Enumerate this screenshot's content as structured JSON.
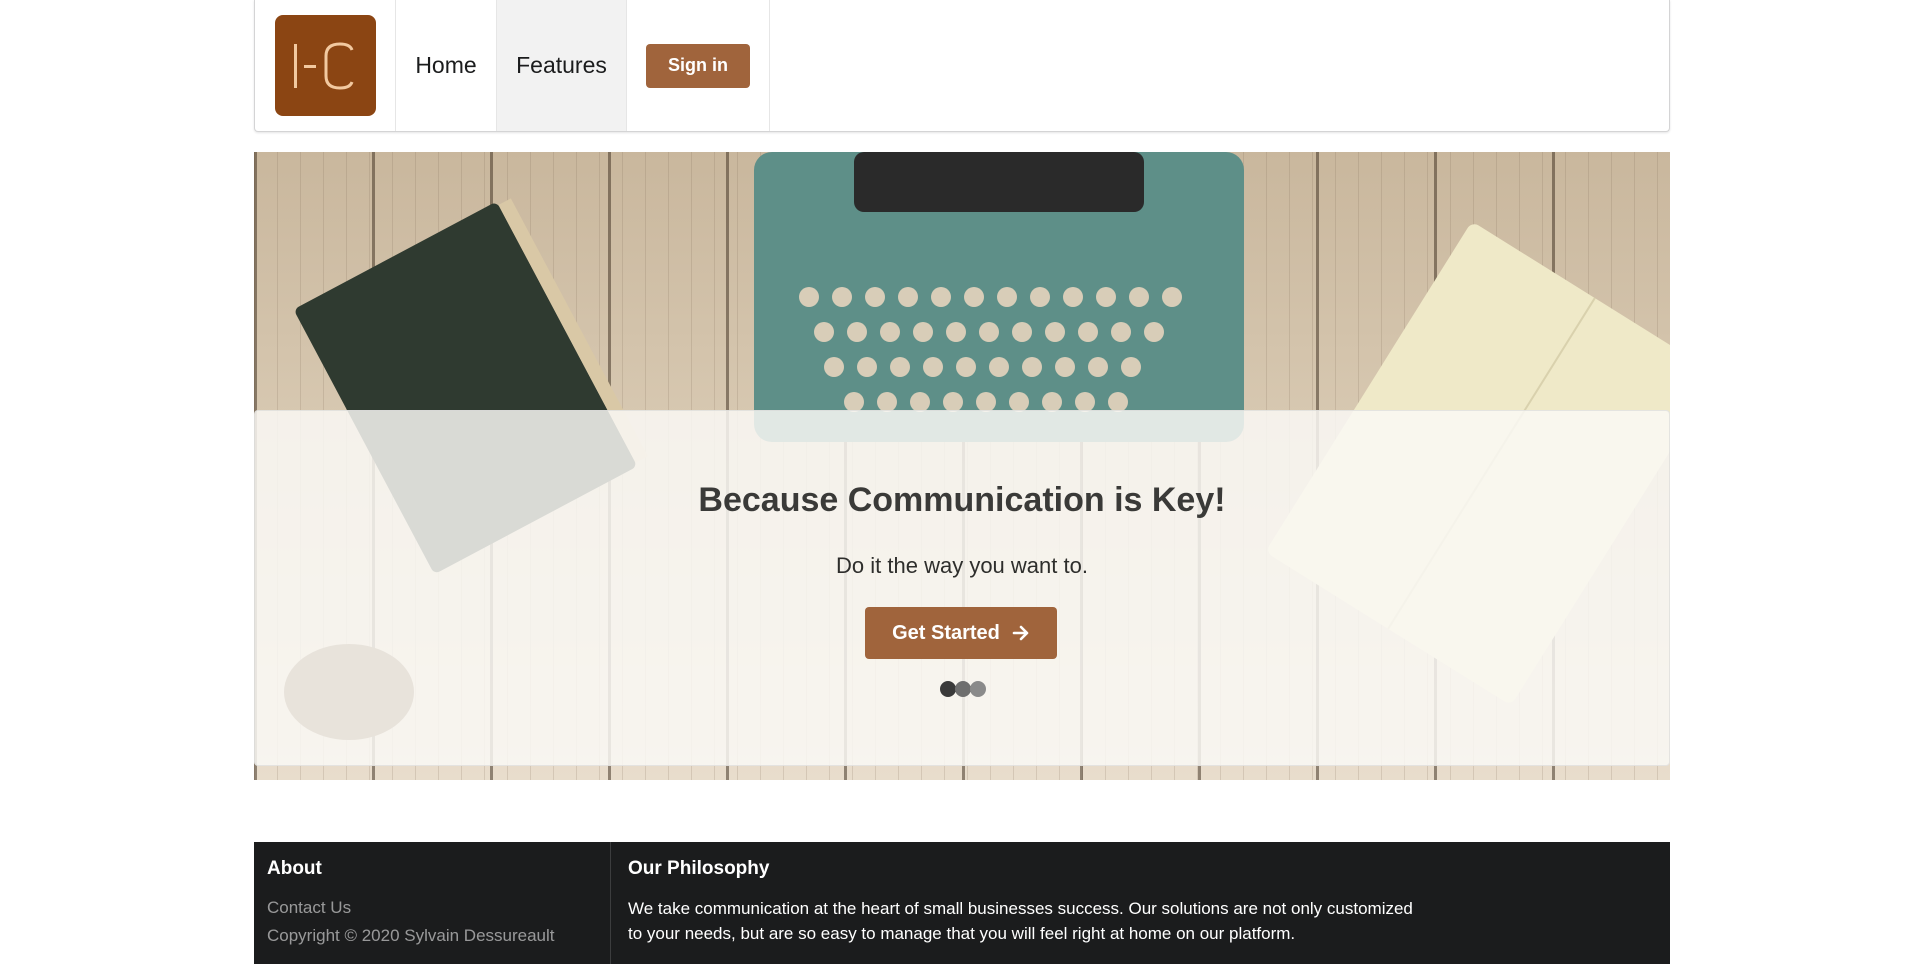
{
  "navbar": {
    "logo_text": "I-C",
    "items": [
      {
        "label": "Home"
      },
      {
        "label": "Features"
      }
    ],
    "signin_label": "Sign in"
  },
  "hero": {
    "title": "Because Communication is Key!",
    "subtitle": "Do it the way you want to.",
    "cta_label": "Get Started",
    "cta_icon": "arrow-right-icon",
    "dots": [
      "#3a3a3a",
      "#6e6e6e",
      "#8a8a8a"
    ]
  },
  "footer": {
    "about_heading": "About",
    "contact_link": "Contact Us",
    "copyright": "Copyright © 2020 Sylvain Dessureault",
    "philosophy_heading": "Our Philosophy",
    "philosophy_text": "We take communication at the heart of small businesses success. Our solutions are not only customized to your needs, but are so easy to manage that you will feel right at home on our platform."
  },
  "colors": {
    "brand": "#8b4513",
    "button": "#a0643c",
    "footer_bg": "#1b1c1d"
  }
}
